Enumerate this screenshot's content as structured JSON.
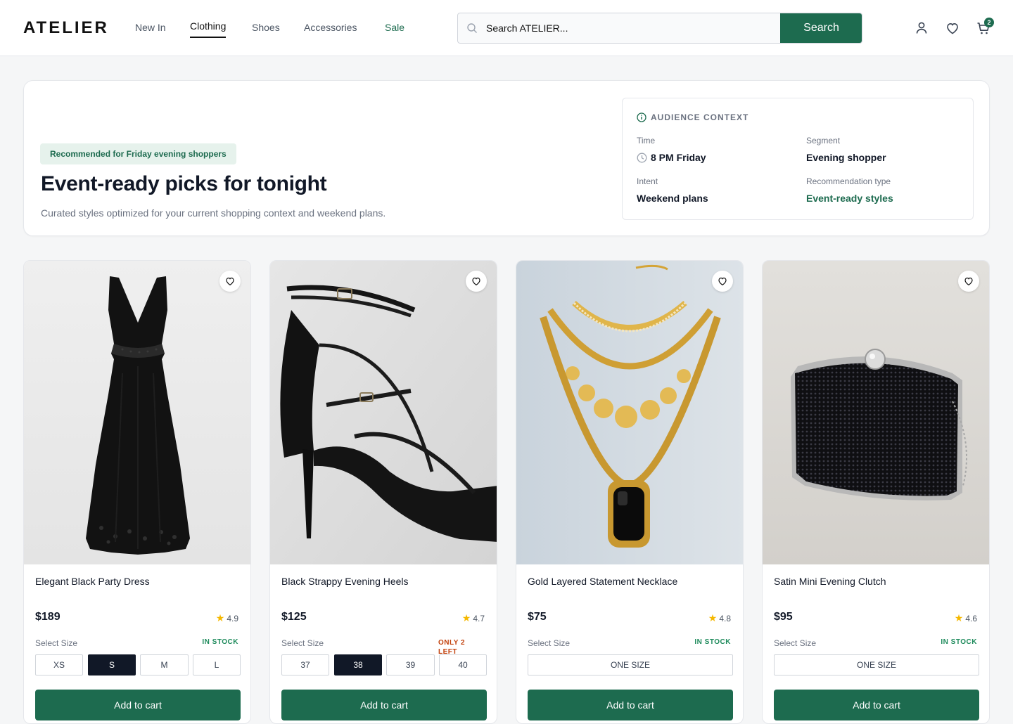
{
  "header": {
    "logo": "ATELIER",
    "nav": [
      "New In",
      "Clothing",
      "Shoes",
      "Accessories",
      "Sale"
    ],
    "active_nav": "Clothing",
    "search_placeholder": "Search ATELIER...",
    "search_button": "Search",
    "cart_count": "2",
    "icons": [
      "account-icon",
      "heart-icon",
      "cart-icon"
    ]
  },
  "hero": {
    "badge": "Recommended for Friday evening shoppers",
    "title": "Event-ready picks for tonight",
    "subtitle": "Curated styles optimized for your current shopping context and weekend plans.",
    "context": {
      "heading": "AUDIENCE CONTEXT",
      "time_label": "Time",
      "time_value": "8 PM Friday",
      "segment_label": "Segment",
      "segment_value": "Evening shopper",
      "intent_label": "Intent",
      "intent_value": "Weekend plans",
      "rectype_label": "Recommendation type",
      "rectype_value": "Event-ready styles"
    }
  },
  "products": [
    {
      "name": "Elegant Black Party Dress",
      "price": "$189",
      "rating": "4.9",
      "size_label": "Select Size",
      "stock": "IN STOCK",
      "sizes": [
        "XS",
        "S",
        "M",
        "L"
      ],
      "selected_size": "S",
      "cta": "Add to cart"
    },
    {
      "name": "Black Strappy Evening Heels",
      "price": "$125",
      "rating": "4.7",
      "size_label": "Select Size",
      "stock": "ONLY 2 LEFT",
      "sizes": [
        "37",
        "38",
        "39",
        "40"
      ],
      "selected_size": "38",
      "cta": "Add to cart"
    },
    {
      "name": "Gold Layered Statement Necklace",
      "price": "$75",
      "rating": "4.8",
      "size_label": "Select Size",
      "stock": "IN STOCK",
      "sizes": [
        "ONE SIZE"
      ],
      "selected_size": "",
      "cta": "Add to cart"
    },
    {
      "name": "Satin Mini Evening Clutch",
      "price": "$95",
      "rating": "4.6",
      "size_label": "Select Size",
      "stock": "IN STOCK",
      "sizes": [
        "ONE SIZE"
      ],
      "selected_size": "",
      "cta": "Add to cart"
    }
  ],
  "colors": {
    "brand_green": "#1d6b4f",
    "ink": "#111827",
    "low_stock": "#c2410c",
    "star": "#f5b800"
  }
}
